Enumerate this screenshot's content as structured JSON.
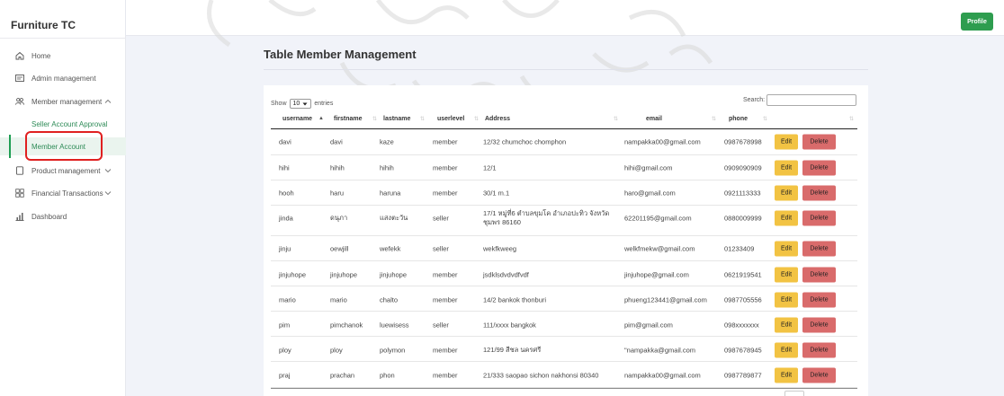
{
  "app": {
    "brand": "Furniture TC"
  },
  "topbar": {
    "profile_label": "Profile"
  },
  "sidebar": {
    "items": [
      {
        "label": "Home",
        "icon": "home-icon"
      },
      {
        "label": "Admin management",
        "icon": "id-card-icon"
      },
      {
        "label": "Member management",
        "icon": "users-icon"
      },
      {
        "label": "Product management",
        "icon": "box-icon"
      },
      {
        "label": "Financial Transactions",
        "icon": "grid-icon"
      },
      {
        "label": "Dashboard",
        "icon": "bar-chart-icon"
      }
    ],
    "sub_items": [
      {
        "label": "Seller Account Approval",
        "active": false
      },
      {
        "label": "Member Account",
        "active": true
      }
    ]
  },
  "page": {
    "title": "Table Member Management"
  },
  "table_controls": {
    "show_label": "Show",
    "entries_value": "10",
    "entries_label": "entries",
    "search_label": "Search:"
  },
  "table": {
    "columns": [
      "username",
      "firstname",
      "lastname",
      "userlevel",
      "Address",
      "email",
      "phone"
    ],
    "edit_label": "Edit",
    "delete_label": "Delete",
    "rows": [
      {
        "username": "davi",
        "firstname": "davi",
        "lastname": "kaze",
        "userlevel": "member",
        "address": "12/32 chumchoc chomphon",
        "email": "nampakka00@gmail.com",
        "phone": "0987678998"
      },
      {
        "username": "hihi",
        "firstname": "hihih",
        "lastname": "hihih",
        "userlevel": "member",
        "address": "12/1",
        "email": "hihi@gmail.com",
        "phone": "0909090909"
      },
      {
        "username": "hooh",
        "firstname": "haru",
        "lastname": "haruna",
        "userlevel": "member",
        "address": "30/1 m.1",
        "email": "haro@gmail.com",
        "phone": "0921113333"
      },
      {
        "username": "jinda",
        "firstname": "ดนุภา",
        "lastname": "แสงตะวัน",
        "userlevel": "seller",
        "address": "17/1 หมู่ที่6 ตำบลขุมโค อำเภอปะทิว จังหวัดชุมพร 86160",
        "email": "62201195@gmail.com",
        "phone": "0880009999"
      },
      {
        "username": "jinju",
        "firstname": "oewjill",
        "lastname": "wefekk",
        "userlevel": "seller",
        "address": "wekfkweeg",
        "email": "welkfmekw@gmail.com",
        "phone": "01233409"
      },
      {
        "username": "jinjuhope",
        "firstname": "jinjuhope",
        "lastname": "jinjuhope",
        "userlevel": "member",
        "address": "jsdklsdvdvdfvdf",
        "email": "jinjuhope@gmail.com",
        "phone": "0621919541"
      },
      {
        "username": "mario",
        "firstname": "mario",
        "lastname": "chalto",
        "userlevel": "member",
        "address": "14/2 bankok thonburi",
        "email": "phueng123441@gmail.com",
        "phone": "0987705556"
      },
      {
        "username": "pim",
        "firstname": "pimchanok",
        "lastname": "luewisess",
        "userlevel": "seller",
        "address": "111/xxxx bangkok",
        "email": "pim@gmail.com",
        "phone": "098xxxxxxx"
      },
      {
        "username": "ploy",
        "firstname": "ploy",
        "lastname": "polymon",
        "userlevel": "member",
        "address": "121/99 สีชล นครศรี",
        "email": "\"nampakka@gmail.com",
        "phone": "0987678945"
      },
      {
        "username": "praj",
        "firstname": "prachan",
        "lastname": "phon",
        "userlevel": "member",
        "address": "21/333 saopao sichon nakhonsi 80340",
        "email": "nampakka00@gmail.com",
        "phone": "0987789877"
      }
    ]
  },
  "colors": {
    "accent": "#2e9d4f",
    "edit": "#f2c343",
    "delete": "#d96b6b",
    "highlight": "#e02020"
  }
}
